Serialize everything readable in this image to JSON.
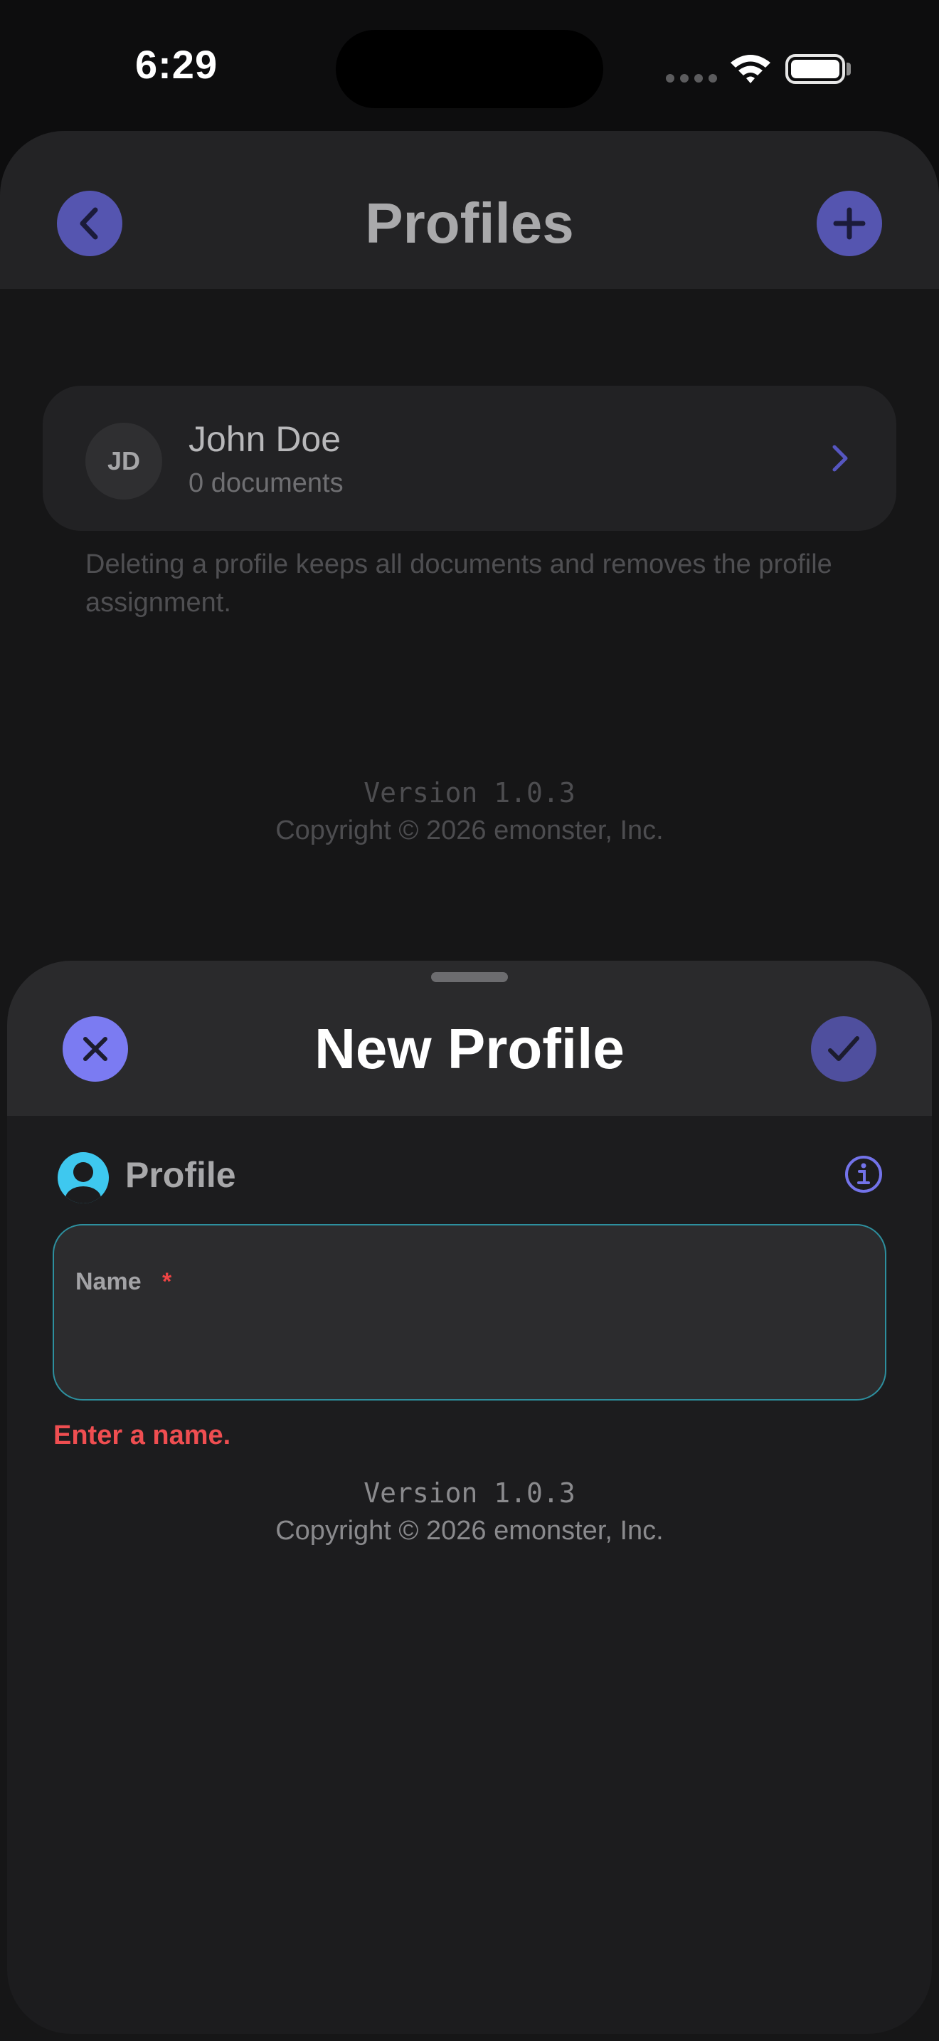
{
  "status_bar": {
    "time": "6:29"
  },
  "background": {
    "title": "Profiles",
    "profile": {
      "initials": "JD",
      "name": "John Doe",
      "documents": "0 documents"
    },
    "note": "Deleting a profile keeps all documents and removes the profile assignment.",
    "version": "Version 1.0.3",
    "copyright": "Copyright © 2026 emonster, Inc."
  },
  "sheet": {
    "title": "New Profile",
    "section_title": "Profile",
    "name_field": {
      "label": "Name",
      "required_mark": "*",
      "value": ""
    },
    "error": "Enter a name.",
    "version": "Version 1.0.3",
    "copyright": "Copyright © 2026 emonster, Inc."
  },
  "colors": {
    "accent": "#7b7bf2",
    "error": "#ef4e51",
    "field_border": "#2d8f9e",
    "profile_icon": "#3ec8ef"
  }
}
